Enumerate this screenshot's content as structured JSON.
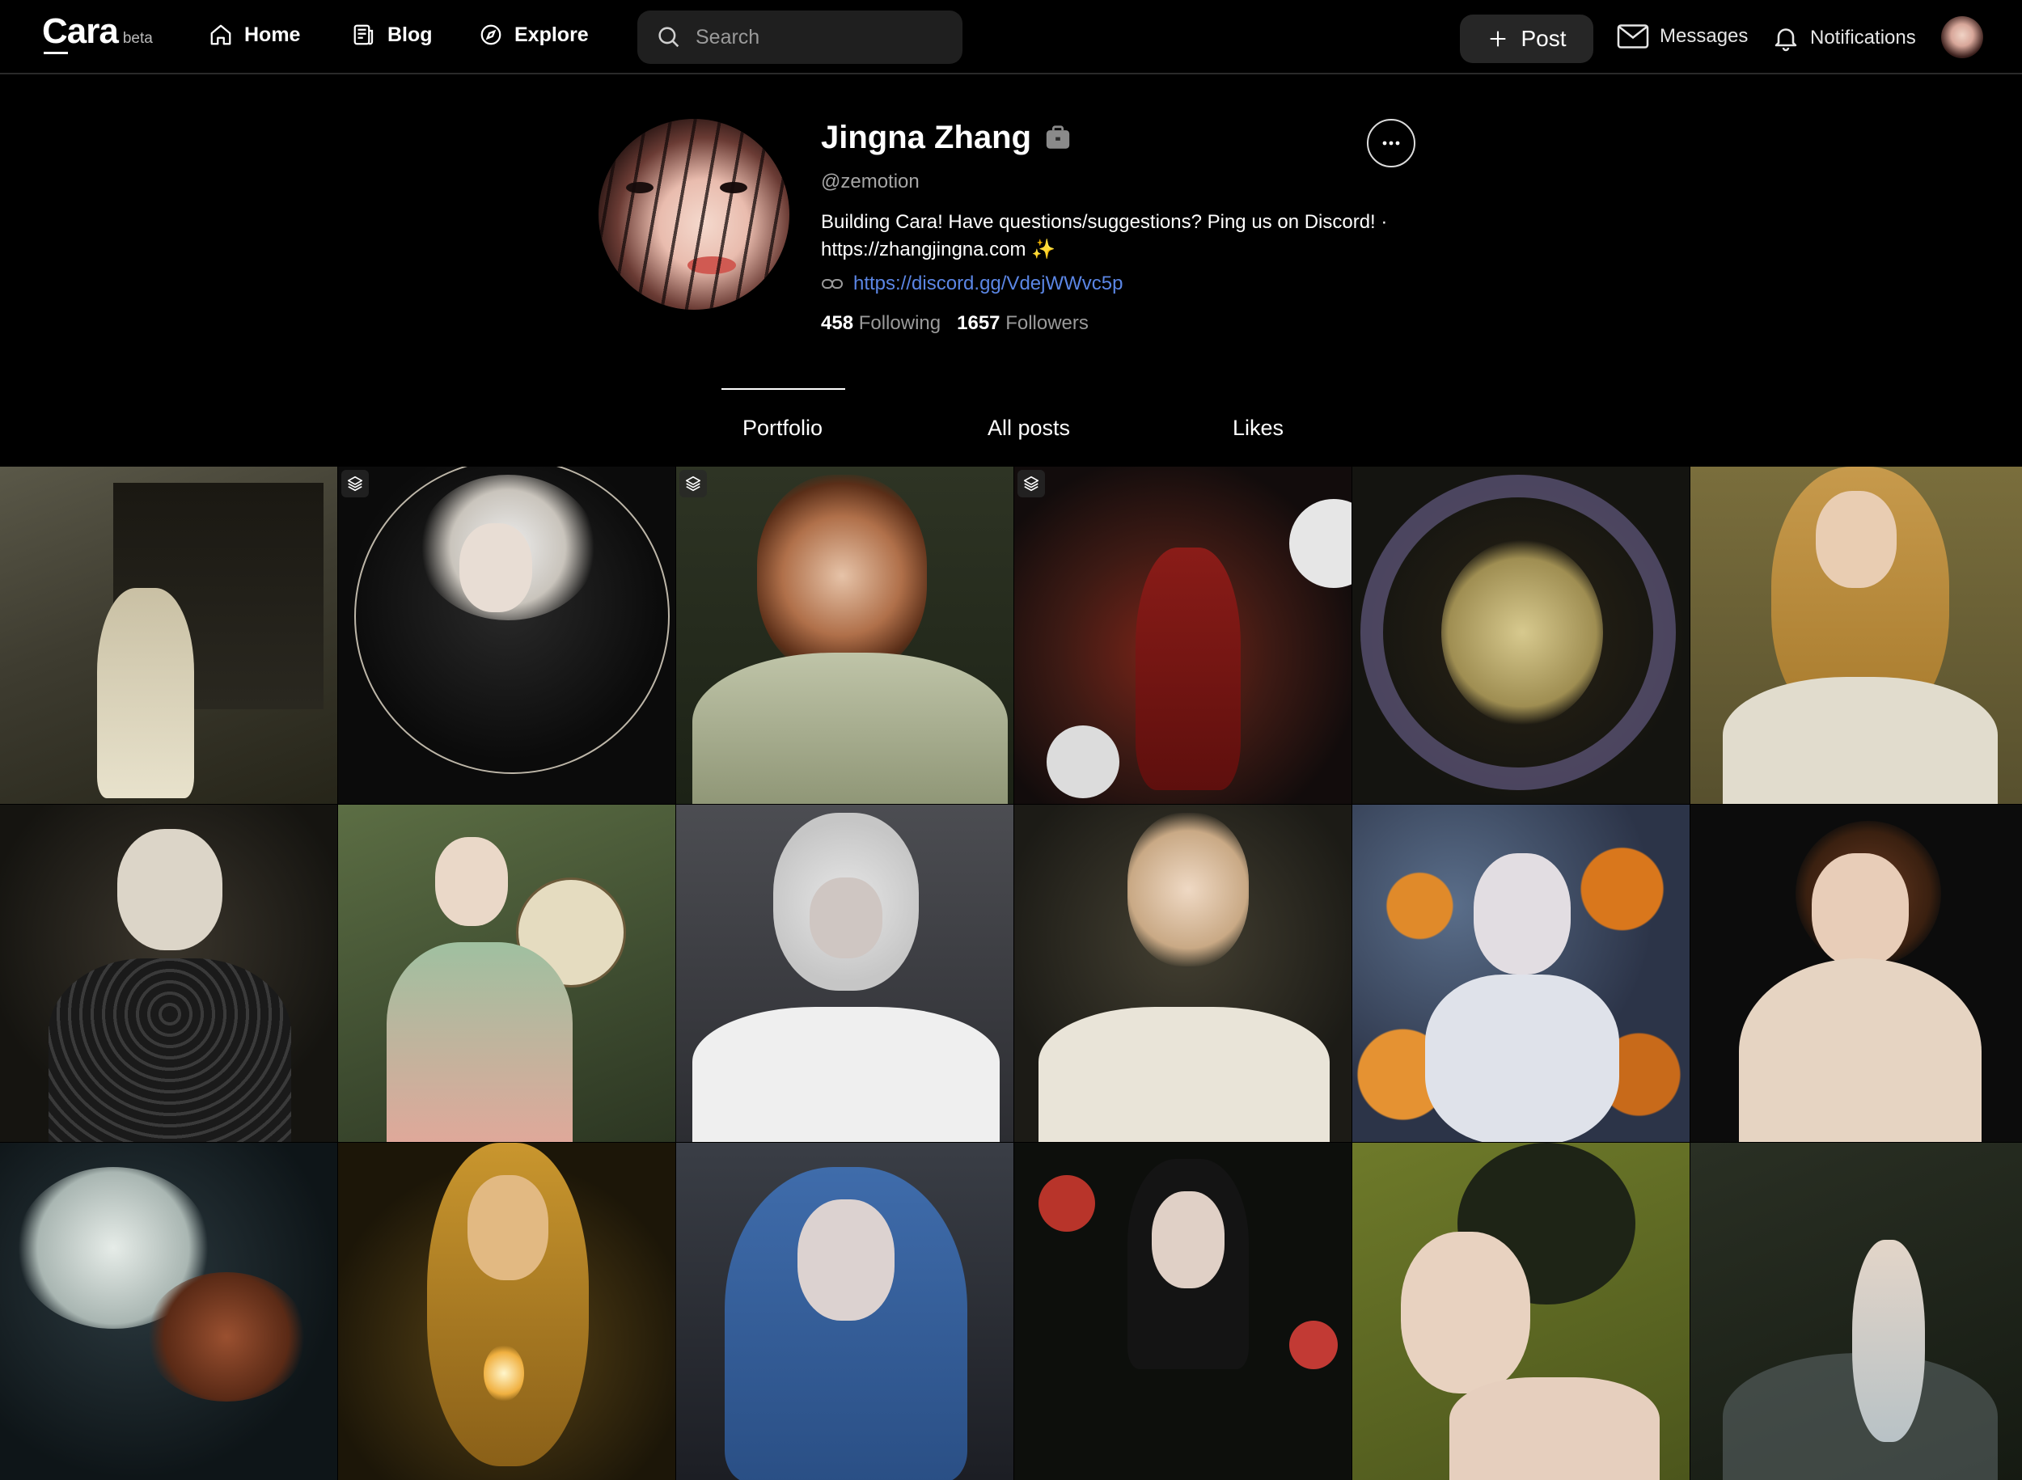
{
  "nav": {
    "brand": "Cara",
    "brand_tag": "beta",
    "links": [
      {
        "label": "Home",
        "icon": "home-icon"
      },
      {
        "label": "Blog",
        "icon": "blog-icon"
      },
      {
        "label": "Explore",
        "icon": "compass-icon"
      }
    ],
    "search_placeholder": "Search",
    "post_label": "Post",
    "messages_label": "Messages",
    "notifications_label": "Notifications"
  },
  "profile": {
    "name": "Jingna Zhang",
    "handle": "@zemotion",
    "bio_line1": "Building Cara! Have questions/suggestions? Ping us on Discord! ·",
    "bio_line2": "https://zhangjingna.com ✨",
    "link": "https://discord.gg/VdejWWvc5p",
    "following_count": "458",
    "following_label": "Following",
    "followers_count": "1657",
    "followers_label": "Followers"
  },
  "tabs": [
    {
      "label": "Portfolio",
      "active": true
    },
    {
      "label": "All posts",
      "active": false
    },
    {
      "label": "Likes",
      "active": false
    }
  ],
  "colors": {
    "background": "#000000",
    "link": "#5b86e5",
    "chip": "#262626"
  },
  "portfolio": [
    {
      "multi": false
    },
    {
      "multi": true
    },
    {
      "multi": true
    },
    {
      "multi": true
    },
    {
      "multi": false
    },
    {
      "multi": false
    },
    {
      "multi": false
    },
    {
      "multi": false
    },
    {
      "multi": false
    },
    {
      "multi": false
    },
    {
      "multi": false
    },
    {
      "multi": false
    },
    {
      "multi": false
    },
    {
      "multi": false
    },
    {
      "multi": false
    },
    {
      "multi": false
    },
    {
      "multi": false
    },
    {
      "multi": false
    }
  ]
}
